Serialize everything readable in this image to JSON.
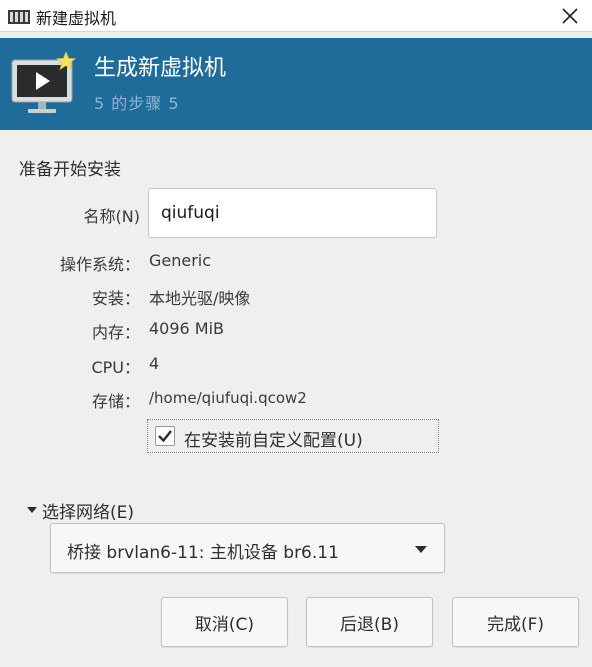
{
  "window": {
    "title": "新建虚拟机"
  },
  "banner": {
    "title": "生成新虚拟机",
    "step": "5 的步骤 5"
  },
  "section": {
    "heading": "准备开始安装"
  },
  "form": {
    "name_label": "名称(N)",
    "name_value": "qiufuqi",
    "os_label": "操作系统：",
    "os_value": "Generic",
    "install_label": "安装：",
    "install_value": "本地光驱/映像",
    "memory_label": "内存：",
    "memory_value": "4096 MiB",
    "cpu_label": "CPU：",
    "cpu_value": "4",
    "storage_label": "存储：",
    "storage_value": "/home/qiufuqi.qcow2",
    "customize_label": "在安装前自定义配置(U)",
    "customize_checked": true
  },
  "network": {
    "expander_label": "选择网络(E)",
    "selected": "桥接 brvlan6-11: 主机设备 br6.11"
  },
  "buttons": {
    "cancel": "取消(C)",
    "back": "后退(B)",
    "finish": "完成(F)"
  },
  "colors": {
    "banner_bg": "#1f6c9a",
    "banner_step": "#8fb4d0",
    "window_bg": "#efefef"
  }
}
